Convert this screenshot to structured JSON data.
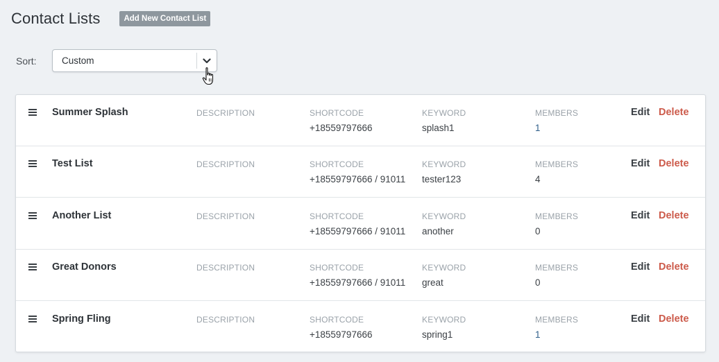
{
  "header": {
    "title": "Contact Lists",
    "add_button_label": "Add New Contact List"
  },
  "sort": {
    "label": "Sort:",
    "selected": "Custom"
  },
  "columns": {
    "description": "DESCRIPTION",
    "shortcode": "SHORTCODE",
    "keyword": "KEYWORD",
    "members": "MEMBERS"
  },
  "actions": {
    "edit": "Edit",
    "delete": "Delete"
  },
  "lists": [
    {
      "name": "Summer Splash",
      "shortcode": "+18559797666",
      "keyword": "splash1",
      "members": "1"
    },
    {
      "name": "Test List",
      "shortcode": "+18559797666 / 91011",
      "keyword": "tester123",
      "members": "4"
    },
    {
      "name": "Another List",
      "shortcode": "+18559797666 / 91011",
      "keyword": "another",
      "members": "0"
    },
    {
      "name": "Great Donors",
      "shortcode": "+18559797666 / 91011",
      "keyword": "great",
      "members": "0"
    },
    {
      "name": "Spring Fling",
      "shortcode": "+18559797666",
      "keyword": "spring1",
      "members": "1"
    }
  ],
  "colors": {
    "background": "#eef1f4",
    "delete": "#cc5a4a",
    "members_value": "#2f5f8a",
    "add_button": "#8e979e"
  }
}
